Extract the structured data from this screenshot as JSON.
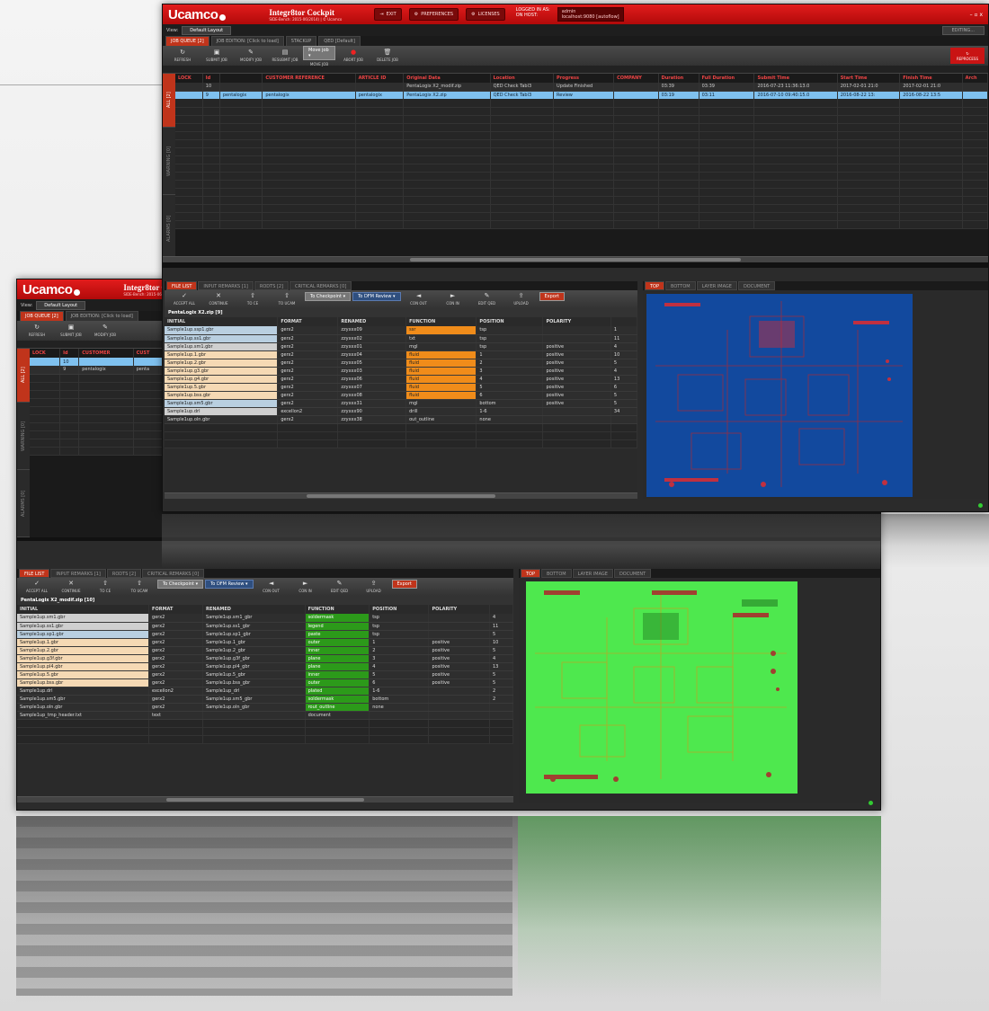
{
  "app": {
    "logo": "Ucamco",
    "name": "Integr8tor Cockpit",
    "version": "SIDE-Bench: 2015-06(2014) | © Ucamco"
  },
  "titlebar": {
    "exit": "EXIT",
    "preferences": "PREFERENCES",
    "licenses": "LICENSES",
    "logged_in_label": "LOGGED IN AS:",
    "logged_in_value": "admin",
    "on_host_label": "ON HOST:",
    "on_host_value": "localhost:9080 [autoflow]",
    "window_controls": "– ▫ x"
  },
  "viewbar": {
    "label": "View:",
    "value": "Default Layout",
    "right": "EDITING..."
  },
  "job_tabs": [
    "JOB QUEUE [2]",
    "JOB EDITION: [Click to load]",
    "STACKUP",
    "QED [Default]"
  ],
  "toolbar": {
    "buttons": [
      "REFRESH",
      "SUBMIT JOB",
      "MODIFY JOB",
      "RESUBMIT JOB",
      "MOVE JOB",
      "ABORT JOB",
      "DELETE JOB"
    ],
    "dropdown": "Move job ▾",
    "reprocess": "REPROCESS"
  },
  "job_table": {
    "columns": [
      "LOCK",
      "Id",
      "",
      "CUSTOMER REFERENCE",
      "ARTICLE ID",
      "Original Data",
      "Location",
      "Progress",
      "COMPANY",
      "Duration",
      "Full Duration",
      "Submit Time",
      "Start Time",
      "Finish Time",
      "Arch"
    ],
    "rows": [
      [
        "",
        "10",
        "",
        "",
        "",
        "PentaLogix X2_modif.zip",
        "QED Check Tabl3",
        "Update Finished",
        "",
        "03:39",
        "03:39",
        "2016-07-23 11:36:13.0",
        "2017-02-01 21:0",
        "2017-02-01 21:0",
        ""
      ],
      [
        "",
        "9",
        "pentalogix",
        "pentalogix",
        "pentalogix",
        "PentaLogix X2.zip",
        "QED Check Tabl3",
        "Review",
        "",
        "03:19",
        "03:11",
        "2016-07-10 09:40:15.0",
        "2016-08-22 13:",
        "2016-08-22 13:5",
        ""
      ]
    ],
    "side_tabs": [
      "ALL [2]",
      "WARNING [0]",
      "ALARMS [0]"
    ]
  },
  "file_panel": {
    "tabs": [
      "FILE LIST",
      "INPUT REMARKS [1]",
      "RODTS [2]",
      "CRITICAL REMARKS [0]"
    ],
    "tools": [
      "ACCEPT ALL",
      "CONTINUE",
      "TO CE",
      "TO UCAM",
      "TO GENCS",
      "TO CHECKPOINT",
      "TO DFM REVIEW",
      "CON OUT",
      "CON IN",
      "EDIT QED",
      "UPLOAD",
      "EXPORT"
    ],
    "dropdown1": "To Checkpoint ▾",
    "dropdown2": "To DFM Review ▾",
    "export": "Export",
    "subtitle_top": "PentaLogix X2.zip [9]",
    "subtitle_bottom": "PentaLogix X2_modif.zip [10]",
    "columns": [
      "INITIAL",
      "FORMAT",
      "RENAMED",
      "FUNCTION",
      "POSITION",
      "POLARITY",
      ""
    ],
    "rows_top": [
      [
        "Sample1up.ssp1.gbr",
        "gerx2",
        "zzyxxx09",
        "ssr",
        "tsp",
        "",
        "1"
      ],
      [
        "Sample1up.ss1.gbr",
        "gerx2",
        "zzyxxx02",
        "txt",
        "tsp",
        "",
        "11"
      ],
      [
        "Sample1up.sm1.gbr",
        "gerx2",
        "zzyxxx01",
        "mgl",
        "tsp",
        "positive",
        "4"
      ],
      [
        "Sample1up.1.gbr",
        "gerx2",
        "zzyxxx04",
        "fluid",
        "1",
        "positive",
        "10"
      ],
      [
        "Sample1up.2.gbr",
        "gerx2",
        "zzyxxx05",
        "fluid",
        "2",
        "positive",
        "5"
      ],
      [
        "Sample1up.g3.gbr",
        "gerx2",
        "zzyxxx03",
        "fluid",
        "3",
        "positive",
        "4"
      ],
      [
        "Sample1up.g4.gbr",
        "gerx2",
        "zzyxxx06",
        "fluid",
        "4",
        "positive",
        "13"
      ],
      [
        "Sample1up.5.gbr",
        "gerx2",
        "zzyxxx07",
        "fluid",
        "5",
        "positive",
        "6"
      ],
      [
        "Sample1up.bss.gbr",
        "gerx2",
        "zzyxxx08",
        "fluid",
        "6",
        "positive",
        "5"
      ],
      [
        "Sample1up.sm5.gbr",
        "gerx2",
        "zzyxxx31",
        "mgl",
        "bottom",
        "positive",
        "5"
      ],
      [
        "Sample1up.drl",
        "excellon2",
        "zzyxxx90",
        "drill",
        "1-6",
        "",
        "34"
      ],
      [
        "Sample1up.oln.gbr",
        "gerx2",
        "zzyxxx38",
        "out_outline",
        "none",
        "",
        ""
      ]
    ],
    "row_classes_top": [
      "blue",
      "blue",
      "gray",
      "tan",
      "tan",
      "tan",
      "tan",
      "tan",
      "tan",
      "blue",
      "gray",
      "none"
    ],
    "fn_classes_top": [
      "or",
      "none",
      "none",
      "or",
      "or",
      "or",
      "or",
      "or",
      "or",
      "none",
      "none",
      "none"
    ],
    "rows_bottom": [
      [
        "Sample1up.sm1.gbr",
        "gerx2",
        "Sample1up.sm1_gbr",
        "soldermask",
        "tsp",
        "",
        "4"
      ],
      [
        "Sample1up.ss1.gbr",
        "gerx2",
        "Sample1up.ss1_gbr",
        "legend",
        "tsp",
        "",
        "11"
      ],
      [
        "Sample1up.sp1.gbr",
        "gerx2",
        "Sample1up.sp1_gbr",
        "paste",
        "tsp",
        "",
        "5"
      ],
      [
        "Sample1up.1.gbr",
        "gerx2",
        "Sample1up.1_gbr",
        "outer",
        "1",
        "positive",
        "10"
      ],
      [
        "Sample1up.2.gbr",
        "gerx2",
        "Sample1up.2_gbr",
        "inner",
        "2",
        "positive",
        "5"
      ],
      [
        "Sample1up.g3f.gbr",
        "gerx2",
        "Sample1up.g3f_gbr",
        "plane",
        "3",
        "positive",
        "4"
      ],
      [
        "Sample1up.pl4.gbr",
        "gerx2",
        "Sample1up.pl4_gbr",
        "plane",
        "4",
        "positive",
        "13"
      ],
      [
        "Sample1up.5.gbr",
        "gerx2",
        "Sample1up.5_gbr",
        "inner",
        "5",
        "positive",
        "5"
      ],
      [
        "Sample1up.bss.gbr",
        "gerx2",
        "Sample1up.bss_gbr",
        "outer",
        "6",
        "positive",
        "5"
      ],
      [
        "Sample1up.drl",
        "excellon2",
        "Sample1up_drl",
        "plated",
        "1-6",
        "",
        "2"
      ],
      [
        "Sample1up.sm5.gbr",
        "gerx2",
        "Sample1up.sm5_gbr",
        "soldermask",
        "bottom",
        "",
        "2"
      ],
      [
        "Sample1up.oln.gbr",
        "gerx2",
        "Sample1up.oln_gbr",
        "rout_outline",
        "none",
        "",
        ""
      ],
      [
        "Sample1up_tmp_header.txt",
        "text",
        "",
        "document",
        "",
        "",
        ""
      ]
    ],
    "row_classes_bottom": [
      "gray",
      "gray",
      "blue",
      "tan",
      "tan",
      "tan",
      "tan",
      "tan",
      "tan",
      "none",
      "none",
      "none",
      "none"
    ],
    "fn_classes_bottom": [
      "gr",
      "gr",
      "gr",
      "gr",
      "gr",
      "gr",
      "gr",
      "gr",
      "gr",
      "gr",
      "gr",
      "gr",
      "none"
    ]
  },
  "viewer_panel": {
    "tabs": [
      "TOP",
      "BOTTOM",
      "LAYER IMAGE",
      "DOCUMENT"
    ]
  },
  "colors": {
    "brand_red": "#c0141b",
    "board_blue": "#12499e",
    "board_green": "#4ee84e",
    "selected_row": "#7fc1ef"
  }
}
